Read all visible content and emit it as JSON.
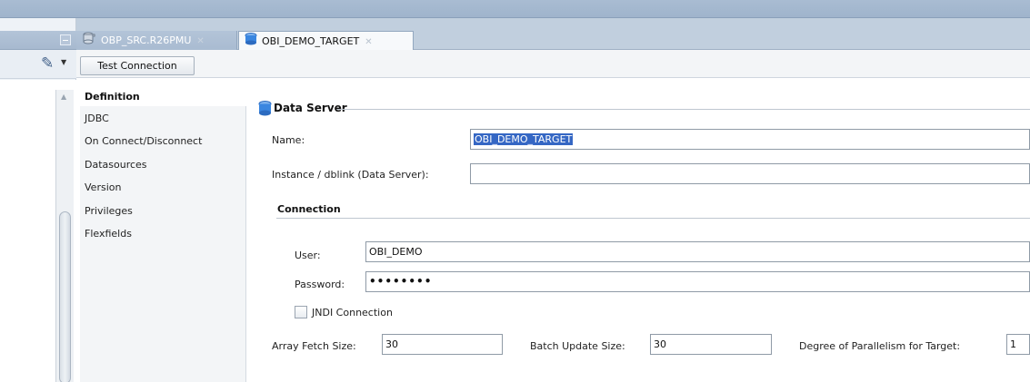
{
  "left_panel": {
    "toolbar_icon": "model-tools-icon"
  },
  "tabs": [
    {
      "label": "OBP_SRC.R26PMU",
      "icon": "database-connection-icon",
      "active": false
    },
    {
      "label": "OBI_DEMO_TARGET",
      "icon": "database-icon",
      "active": true
    }
  ],
  "toolbar": {
    "test_connection_label": "Test Connection"
  },
  "nav": {
    "items": [
      {
        "label": "Definition",
        "selected": true
      },
      {
        "label": "JDBC"
      },
      {
        "label": "On Connect/Disconnect"
      },
      {
        "label": "Datasources"
      },
      {
        "label": "Version"
      },
      {
        "label": "Privileges"
      },
      {
        "label": "Flexfields"
      }
    ]
  },
  "form": {
    "section_title": "Data Server",
    "name_label": "Name:",
    "name_value": "OBI_DEMO_TARGET",
    "instance_label": "Instance / dblink (Data Server):",
    "instance_value": "",
    "connection_title": "Connection",
    "user_label": "User:",
    "user_value": "OBI_DEMO",
    "password_label": "Password:",
    "password_value": "••••••••",
    "jndi_label": "JNDI Connection",
    "jndi_checked": false,
    "array_fetch_label": "Array Fetch Size:",
    "array_fetch_value": "30",
    "batch_update_label": "Batch Update Size:",
    "batch_update_value": "30",
    "parallelism_label": "Degree of Parallelism for Target:",
    "parallelism_value": "1"
  },
  "colors": {
    "accent": "#3567c4",
    "tab_bar": "#c1cfde",
    "panel": "#f3f5f7"
  }
}
